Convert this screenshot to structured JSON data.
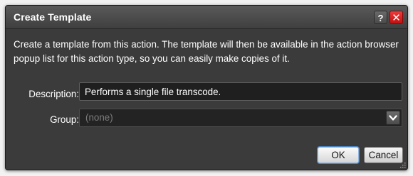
{
  "dialog": {
    "title": "Create Template",
    "help_label": "?",
    "close_label": "✕",
    "message": "Create a template from this action.  The template will then be available in the action browser popup list for this action type, so you can easily make copies of it.",
    "description": {
      "label": "Description:",
      "value": "Performs a single file transcode."
    },
    "group": {
      "label": "Group:",
      "selected": "(none)"
    },
    "buttons": {
      "ok": "OK",
      "cancel": "Cancel"
    }
  },
  "icons": {
    "help": "help-icon",
    "close": "close-icon",
    "dropdown": "chevron-down-icon",
    "resize": "resize-grip-icon"
  },
  "colors": {
    "dialog_bg": "#3b3b3b",
    "close_red": "#d61f1f",
    "ok_focus": "#4c88c7"
  }
}
